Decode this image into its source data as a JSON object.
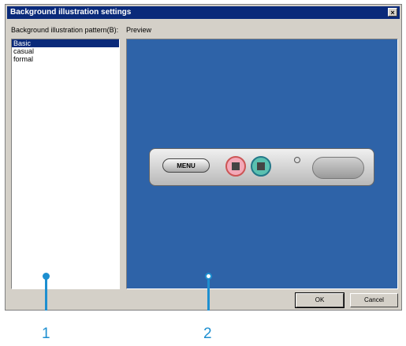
{
  "dialog": {
    "title": "Background illustration settings",
    "close_label": "×",
    "pattern_label": "Background illustration pattern(B):",
    "preview_label": "Preview",
    "patterns": [
      "Basic",
      "casual",
      "formal"
    ],
    "selected_pattern": "Basic",
    "preview_menu_label": "MENU",
    "ok_label": "OK",
    "cancel_label": "Cancel"
  },
  "callouts": [
    "1",
    "2"
  ],
  "colors": {
    "titlebar": "#0a2a7a",
    "preview_bg": "#2e63a8",
    "callout": "#1d8fd0"
  }
}
